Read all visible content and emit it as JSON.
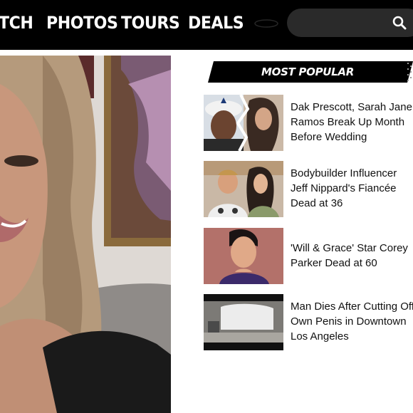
{
  "nav": {
    "items": [
      "TCH",
      "PHOTOS",
      "TOURS",
      "DEALS"
    ]
  },
  "search": {
    "value": "",
    "icon": "search-icon"
  },
  "most_popular": {
    "title": "MOST POPULAR",
    "stories": [
      {
        "title": "Dak Prescott, Sarah Jane Ramos Break Up Month Before Wedding"
      },
      {
        "title": "Bodybuilder Influencer Jeff Nippard's Fiancée Dead at 36"
      },
      {
        "title": "'Will & Grace' Star Corey Parker Dead at 60"
      },
      {
        "title": "Man Dies After Cutting Off Own Penis in Downtown Los Angeles"
      }
    ]
  },
  "colors": {
    "topbar": "#000000",
    "search_bg": "#2a2a2a",
    "header_banner": "#000000",
    "text": "#111111"
  }
}
